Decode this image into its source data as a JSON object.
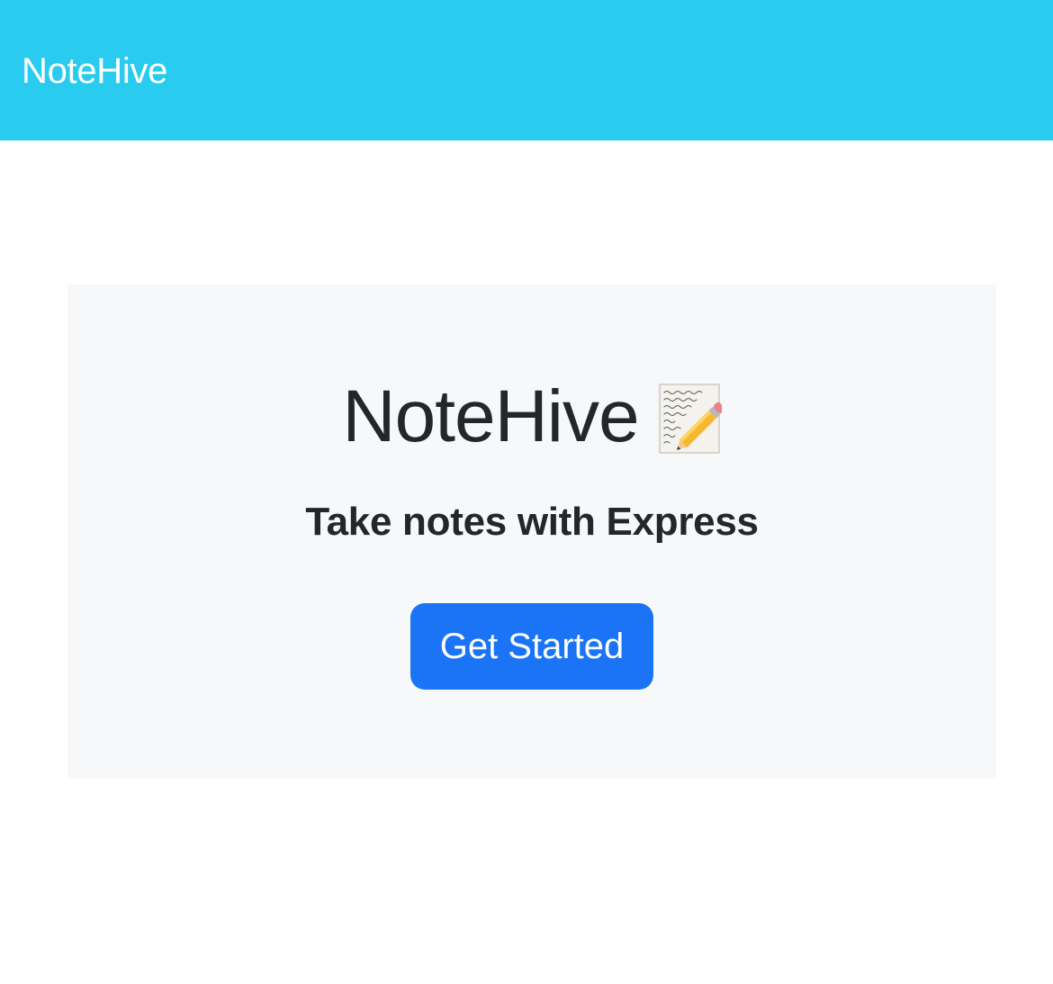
{
  "navbar": {
    "brand": "NoteHive",
    "background_color": "#29cbee"
  },
  "hero": {
    "title": "NoteHive",
    "title_icon": "memo-icon",
    "subtitle": "Take notes with Express",
    "button_label": "Get Started",
    "button_color": "#1a74f5",
    "background_color": "#f7f8fa"
  }
}
